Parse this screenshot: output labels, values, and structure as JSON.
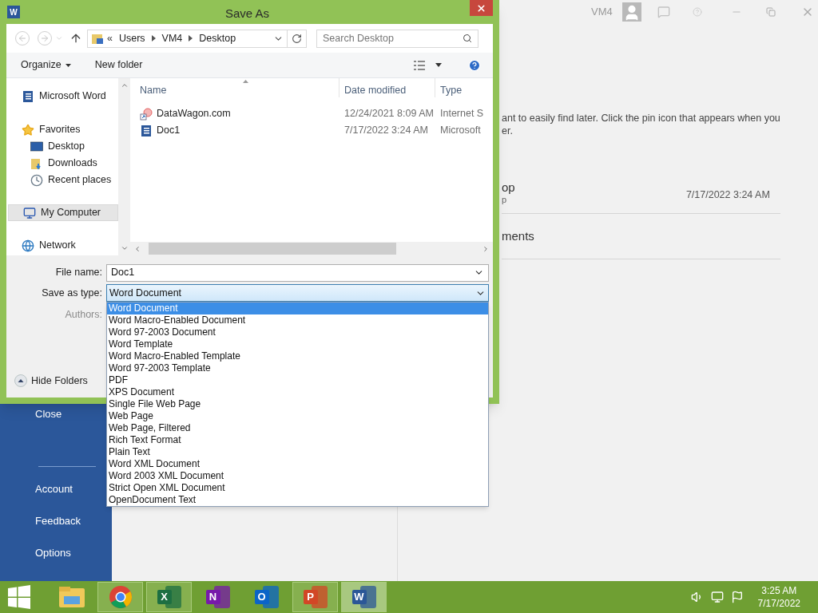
{
  "backstage": {
    "nav": [
      {
        "label": "Close"
      },
      {
        "label": "Account"
      },
      {
        "label": "Feedback"
      },
      {
        "label": "Options"
      }
    ],
    "user": "VM4",
    "hint_lines": [
      "ant to easily find later. Click the pin icon that appears when you",
      "er."
    ],
    "recent": [
      {
        "name": "op",
        "sub": "p",
        "date": "7/17/2022 3:24 AM"
      },
      {
        "name": "ments"
      }
    ]
  },
  "dialog": {
    "title": "Save As",
    "icon_letter": "W",
    "breadcrumb_prefix": "«",
    "breadcrumb": [
      "Users",
      "VM4",
      "Desktop"
    ],
    "search": {
      "placeholder": "Search Desktop"
    },
    "toolbar": [
      "Organize",
      "New folder"
    ],
    "nav_pane": [
      {
        "label": "Microsoft Word",
        "kind": "word",
        "selected": false
      },
      {
        "label": "Favorites",
        "kind": "star",
        "selected": false,
        "children": [
          {
            "label": "Desktop",
            "kind": "desktop",
            "selected": false
          },
          {
            "label": "Downloads",
            "kind": "downloads",
            "selected": false
          },
          {
            "label": "Recent places",
            "kind": "recent",
            "selected": false
          }
        ]
      },
      {
        "label": "My Computer",
        "kind": "computer",
        "selected": true
      },
      {
        "label": "Network",
        "kind": "network",
        "selected": false
      }
    ],
    "columns": [
      "Name",
      "Date modified",
      "Type"
    ],
    "files": [
      {
        "name": "DataWagon.com",
        "kind": "shortcut",
        "date": "12/24/2021 8:09 AM",
        "type": "Internet S"
      },
      {
        "name": "Doc1",
        "kind": "word",
        "date": "7/17/2022 3:24 AM",
        "type": "Microsoft"
      }
    ],
    "file_name": {
      "label": "File name:",
      "value": "Doc1"
    },
    "save_type": {
      "label": "Save as type:",
      "value": "Word Document"
    },
    "authors_label": "Authors:",
    "hide_folders": "Hide Folders",
    "type_options": [
      {
        "label": "Word Document",
        "selected": true
      },
      {
        "label": "Word Macro-Enabled Document",
        "selected": false
      },
      {
        "label": "Word 97-2003 Document",
        "selected": false
      },
      {
        "label": "Word Template",
        "selected": false
      },
      {
        "label": "Word Macro-Enabled Template",
        "selected": false
      },
      {
        "label": "Word 97-2003 Template",
        "selected": false
      },
      {
        "label": "PDF",
        "selected": false
      },
      {
        "label": "XPS Document",
        "selected": false
      },
      {
        "label": "Single File Web Page",
        "selected": false
      },
      {
        "label": "Web Page",
        "selected": false
      },
      {
        "label": "Web Page, Filtered",
        "selected": false
      },
      {
        "label": "Rich Text Format",
        "selected": false
      },
      {
        "label": "Plain Text",
        "selected": false
      },
      {
        "label": "Word XML Document",
        "selected": false
      },
      {
        "label": "Word 2003 XML Document",
        "selected": false
      },
      {
        "label": "Strict Open XML Document",
        "selected": false
      },
      {
        "label": "OpenDocument Text",
        "selected": false
      }
    ]
  },
  "taskbar": {
    "apps": [
      {
        "kind": "explorer",
        "running": false,
        "selected": false
      },
      {
        "kind": "chrome",
        "running": true,
        "selected": false
      },
      {
        "kind": "excel",
        "letter": "X",
        "running": true,
        "selected": false
      },
      {
        "kind": "onenote",
        "letter": "N",
        "running": false,
        "selected": false
      },
      {
        "kind": "outlook",
        "letter": "O",
        "running": false,
        "selected": false
      },
      {
        "kind": "powerpoint",
        "letter": "P",
        "running": true,
        "selected": false
      },
      {
        "kind": "word",
        "letter": "W",
        "running": true,
        "selected": true
      }
    ],
    "time": "3:25 AM",
    "date": "7/17/2022"
  }
}
